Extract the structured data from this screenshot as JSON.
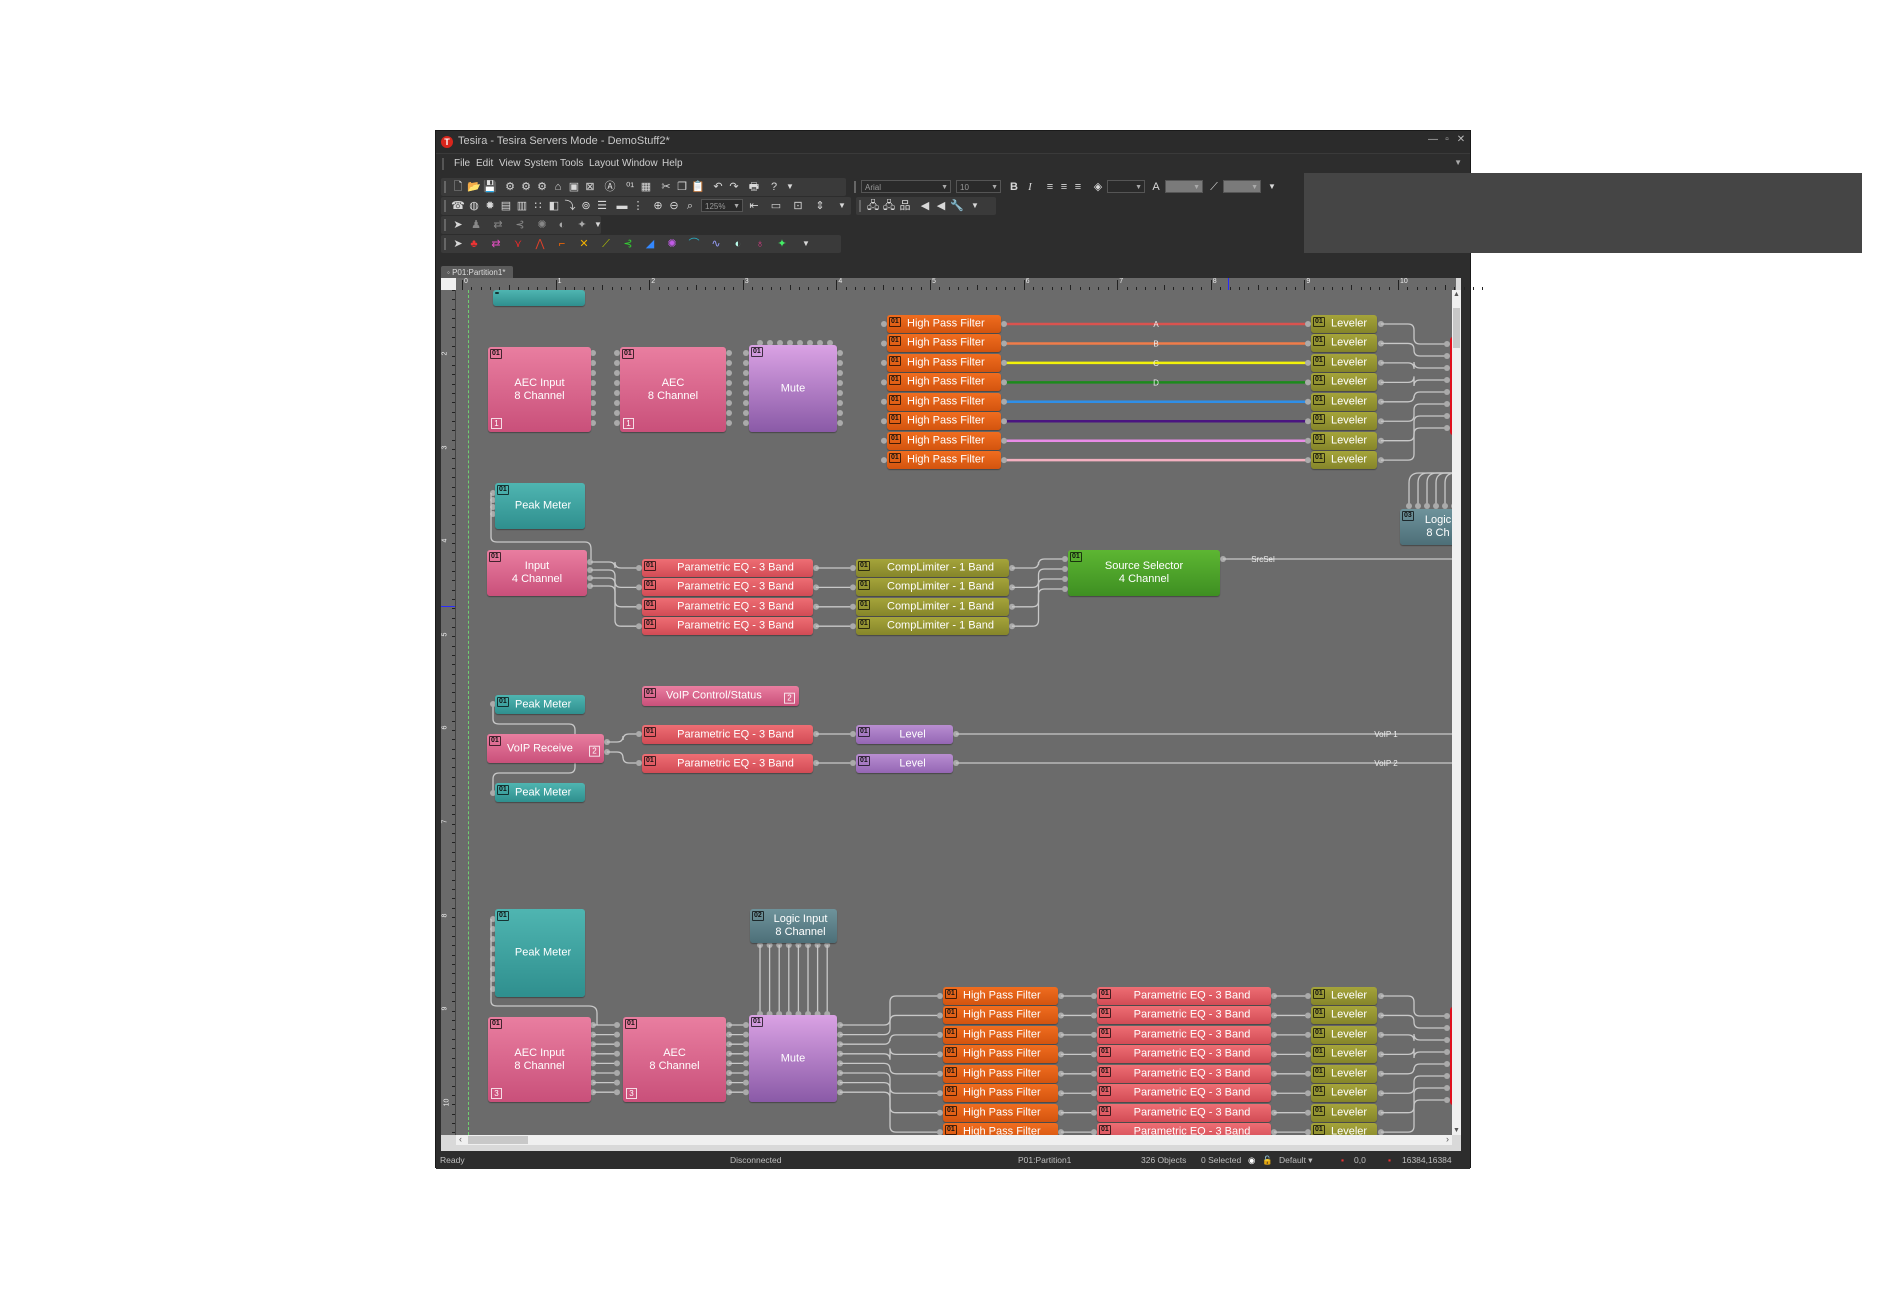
{
  "window": {
    "title": "Tesira - Tesira Servers Mode - DemoStuff2*",
    "controls": {
      "minimize": "—",
      "restore": "▫",
      "close": "✕"
    }
  },
  "menu": [
    "File",
    "Edit",
    "View",
    "System",
    "Tools",
    "Layout",
    "Window",
    "Help"
  ],
  "toolbar": {
    "font_name": "Arial",
    "font_size": "10",
    "zoom": "125%",
    "bold": "B",
    "italic": "I"
  },
  "tab": {
    "label": "P01:Partition1*"
  },
  "rulers": {
    "horizontal": [
      "0",
      "1",
      "2",
      "3",
      "4",
      "5",
      "6",
      "7",
      "8",
      "9",
      "10"
    ],
    "vertical": [
      "2",
      "3",
      "4",
      "5",
      "6",
      "7",
      "8",
      "9",
      "10"
    ]
  },
  "canvas": {
    "row1": {
      "aec_input": {
        "title": "AEC Input\n8 Channel",
        "badge": "01",
        "count": "1"
      },
      "aec": {
        "title": "AEC\n8 Channel",
        "badge": "01",
        "count": "1"
      },
      "mute": {
        "title": "Mute",
        "badge": "01"
      },
      "hpf": {
        "label": "High Pass Filter",
        "badge": "01",
        "count": 8
      },
      "leveler": {
        "label": "Leveler",
        "badge": "01",
        "count": 8
      },
      "wire_labels": [
        "A",
        "B",
        "C",
        "D"
      ],
      "wire_colors": [
        "#d9534f",
        "#f07c4a",
        "#f2f20a",
        "#1c8a1c",
        "#2f8fe8",
        "#4a1580",
        "#e98be8",
        "#f4b0c0"
      ]
    },
    "row2": {
      "peak_meter": {
        "title": "Peak Meter",
        "badge": "01"
      },
      "input": {
        "title": "Input\n4 Channel",
        "badge": "01"
      },
      "peq": {
        "label": "Parametric EQ - 3 Band",
        "badge": "01",
        "count": 4
      },
      "complimiter": {
        "label": "CompLimiter - 1 Band",
        "badge": "01",
        "count": 4
      },
      "source_selector": {
        "title": "Source Selector\n4 Channel",
        "badge": "01"
      },
      "wire_label": "SrcSel",
      "logic": {
        "title": "Logic\n8 Ch",
        "badge": "03"
      }
    },
    "row3": {
      "peak_meter_top": {
        "label": "Peak Meter",
        "badge": "01"
      },
      "voip_control": {
        "label": "VoIP Control/Status",
        "badge": "01",
        "count": "2"
      },
      "voip_receive": {
        "label": "VoIP Receive",
        "badge": "01",
        "count": "2"
      },
      "peq": {
        "label": "Parametric EQ - 3 Band",
        "badge": "01",
        "count": 2
      },
      "level": {
        "label": "Level",
        "badge": "01",
        "count": 2
      },
      "peak_meter_bottom": {
        "label": "Peak Meter",
        "badge": "01"
      },
      "wire_labels": [
        "VoIP 1",
        "VoIP 2"
      ]
    },
    "row4": {
      "peak_meter": {
        "title": "Peak Meter",
        "badge": "01"
      },
      "logic_input": {
        "title": "Logic Input\n8 Channel",
        "badge": "02"
      },
      "aec_input": {
        "title": "AEC Input\n8 Channel",
        "badge": "01",
        "count": "3"
      },
      "aec": {
        "title": "AEC\n8 Channel",
        "badge": "01",
        "count": "3"
      },
      "mute": {
        "title": "Mute",
        "badge": "01"
      },
      "hpf": {
        "label": "High Pass Filter",
        "badge": "01",
        "count": 8
      },
      "peq": {
        "label": "Parametric EQ - 3 Band",
        "badge": "01",
        "count": 8
      },
      "leveler": {
        "label": "Leveler",
        "badge": "01",
        "count": 8
      }
    }
  },
  "status": {
    "state": "Ready",
    "connection": "Disconnected",
    "partition": "P01:Partition1",
    "objects": "326 Objects",
    "selected": "0 Selected",
    "layer": "Default",
    "origin": "0,0",
    "size": "16384,16384"
  }
}
